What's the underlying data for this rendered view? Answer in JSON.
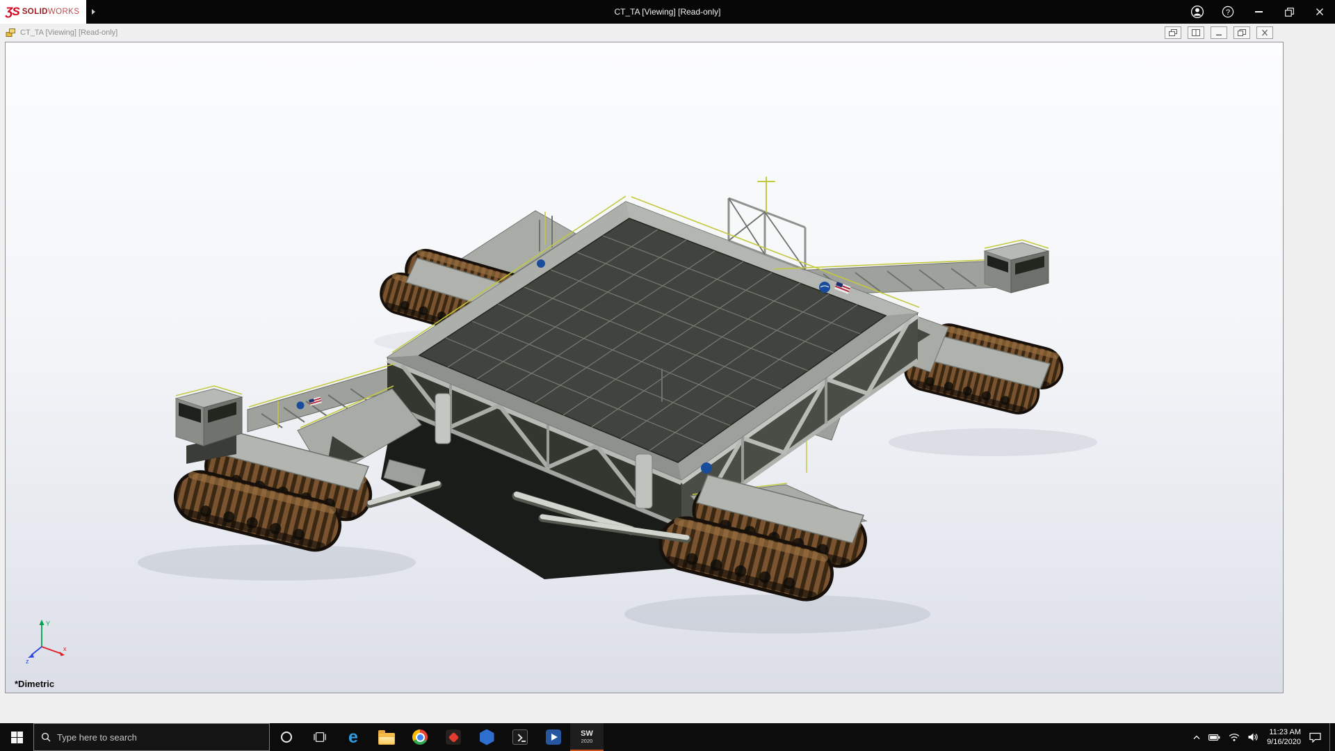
{
  "app": {
    "brand_mark": "ƷS",
    "brand_solid": "SOLID",
    "brand_works": "WORKS",
    "title": "CT_TA [Viewing] [Read-only]",
    "window_controls": {
      "help_glyph": "?"
    }
  },
  "doc_window": {
    "title": "CT_TA [Viewing] [Read-only]"
  },
  "viewport": {
    "view_label": "*Dimetric",
    "triad": {
      "x_label": "x",
      "y_label": "Y",
      "z_label": "z"
    }
  },
  "taskbar": {
    "search_placeholder": "Type here to search",
    "edge_glyph": "e",
    "sw_mark": "SW",
    "sw_year": "2020",
    "tray": {
      "time": "11:23 AM",
      "date": "9/16/2020"
    }
  },
  "icons": {
    "start": "windows-logo",
    "search": "magnifier",
    "cortana": "circle-ring",
    "task_view": "window-panes",
    "apps": [
      "edge-e",
      "file-explorer-folder",
      "chrome-ring",
      "red-diamond-app",
      "blue-hexagon-app",
      "terminal",
      "media-player",
      "solidworks-2020"
    ],
    "tray": [
      "chevron-up",
      "battery",
      "wifi",
      "volume",
      "action-center"
    ]
  },
  "colors": {
    "solidworks_red": "#d6001c",
    "running_app_underline": "#c8511b",
    "nasa_blue": "#1a4c9c",
    "track_brown": "#7a5430",
    "deck_gray": "#41443e",
    "rail_yellow": "#c3c93e"
  }
}
